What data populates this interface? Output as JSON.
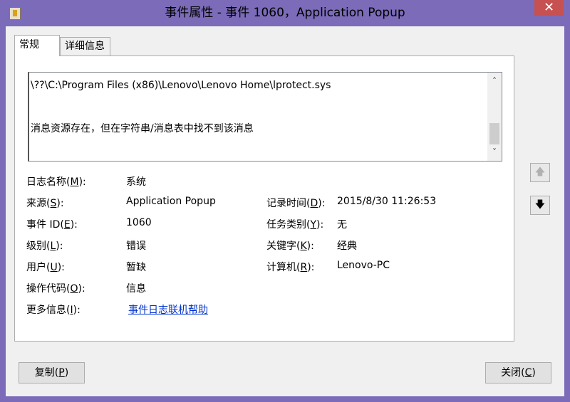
{
  "window": {
    "title": "事件属性 - 事件 1060，Application Popup",
    "close_glyph": "✕"
  },
  "tabs": [
    {
      "label": "常规"
    },
    {
      "label": "详细信息"
    }
  ],
  "description": {
    "line1": "\\??\\C:\\Program Files (x86)\\Lenovo\\Lenovo Home\\lprotect.sys",
    "line2": "消息资源存在，但在字符串/消息表中找不到该消息"
  },
  "fields": {
    "log_name": {
      "label_pre": "日志名称(",
      "key": "M",
      "label_post": "):",
      "value": "系统"
    },
    "source": {
      "label_pre": "来源(",
      "key": "S",
      "label_post": "):",
      "value": "Application Popup"
    },
    "logged": {
      "label_pre": "记录时间(",
      "key": "D",
      "label_post": "):",
      "value": "2015/8/30 11:26:53"
    },
    "event_id": {
      "label_pre": "事件 ID(",
      "key": "E",
      "label_post": "):",
      "value": "1060"
    },
    "task_category": {
      "label_pre": "任务类别(",
      "key": "Y",
      "label_post": "):",
      "value": "无"
    },
    "level": {
      "label_pre": "级别(",
      "key": "L",
      "label_post": "):",
      "value": "错误"
    },
    "keywords": {
      "label_pre": "关键字(",
      "key": "K",
      "label_post": "):",
      "value": "经典"
    },
    "user": {
      "label_pre": "用户(",
      "key": "U",
      "label_post": "):",
      "value": "暂缺"
    },
    "computer": {
      "label_pre": "计算机(",
      "key": "R",
      "label_post": "):",
      "value": "Lenovo-PC"
    },
    "opcode": {
      "label_pre": "操作代码(",
      "key": "O",
      "label_post": "):",
      "value": "信息"
    },
    "more_info": {
      "label_pre": "更多信息(",
      "key": "I",
      "label_post": "):",
      "value": "事件日志联机帮助"
    }
  },
  "side_buttons": {
    "up_glyph": "🡅",
    "down_glyph": "🡇"
  },
  "buttons": {
    "copy": {
      "pre": "复制(",
      "key": "P",
      "post": ")"
    },
    "close": {
      "pre": "关闭(",
      "key": "C",
      "post": ")"
    }
  },
  "scroll": {
    "up_glyph": "˄",
    "down_glyph": "˅"
  }
}
